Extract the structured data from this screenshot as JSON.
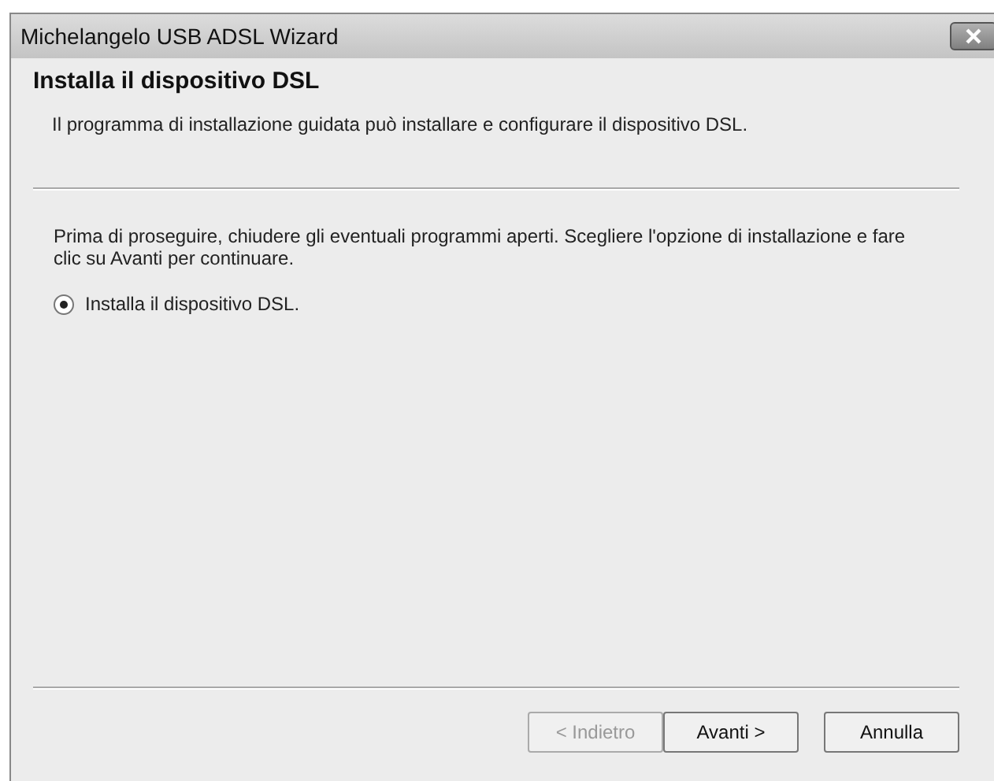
{
  "window": {
    "title": "Michelangelo USB ADSL Wizard"
  },
  "header": {
    "title": "Installa il dispositivo DSL",
    "subtitle": "Il programma di installazione guidata può installare e configurare il dispositivo DSL."
  },
  "body": {
    "instructions": "Prima di proseguire, chiudere gli eventuali programmi aperti. Scegliere l'opzione di installazione e fare clic su Avanti per continuare.",
    "options": [
      {
        "label": "Installa il dispositivo DSL.",
        "selected": true
      }
    ]
  },
  "buttons": [
    {
      "label": "< Indietro",
      "disabled": true
    },
    {
      "label": "Avanti >",
      "disabled": false
    },
    {
      "label": "Annulla",
      "disabled": false
    }
  ]
}
